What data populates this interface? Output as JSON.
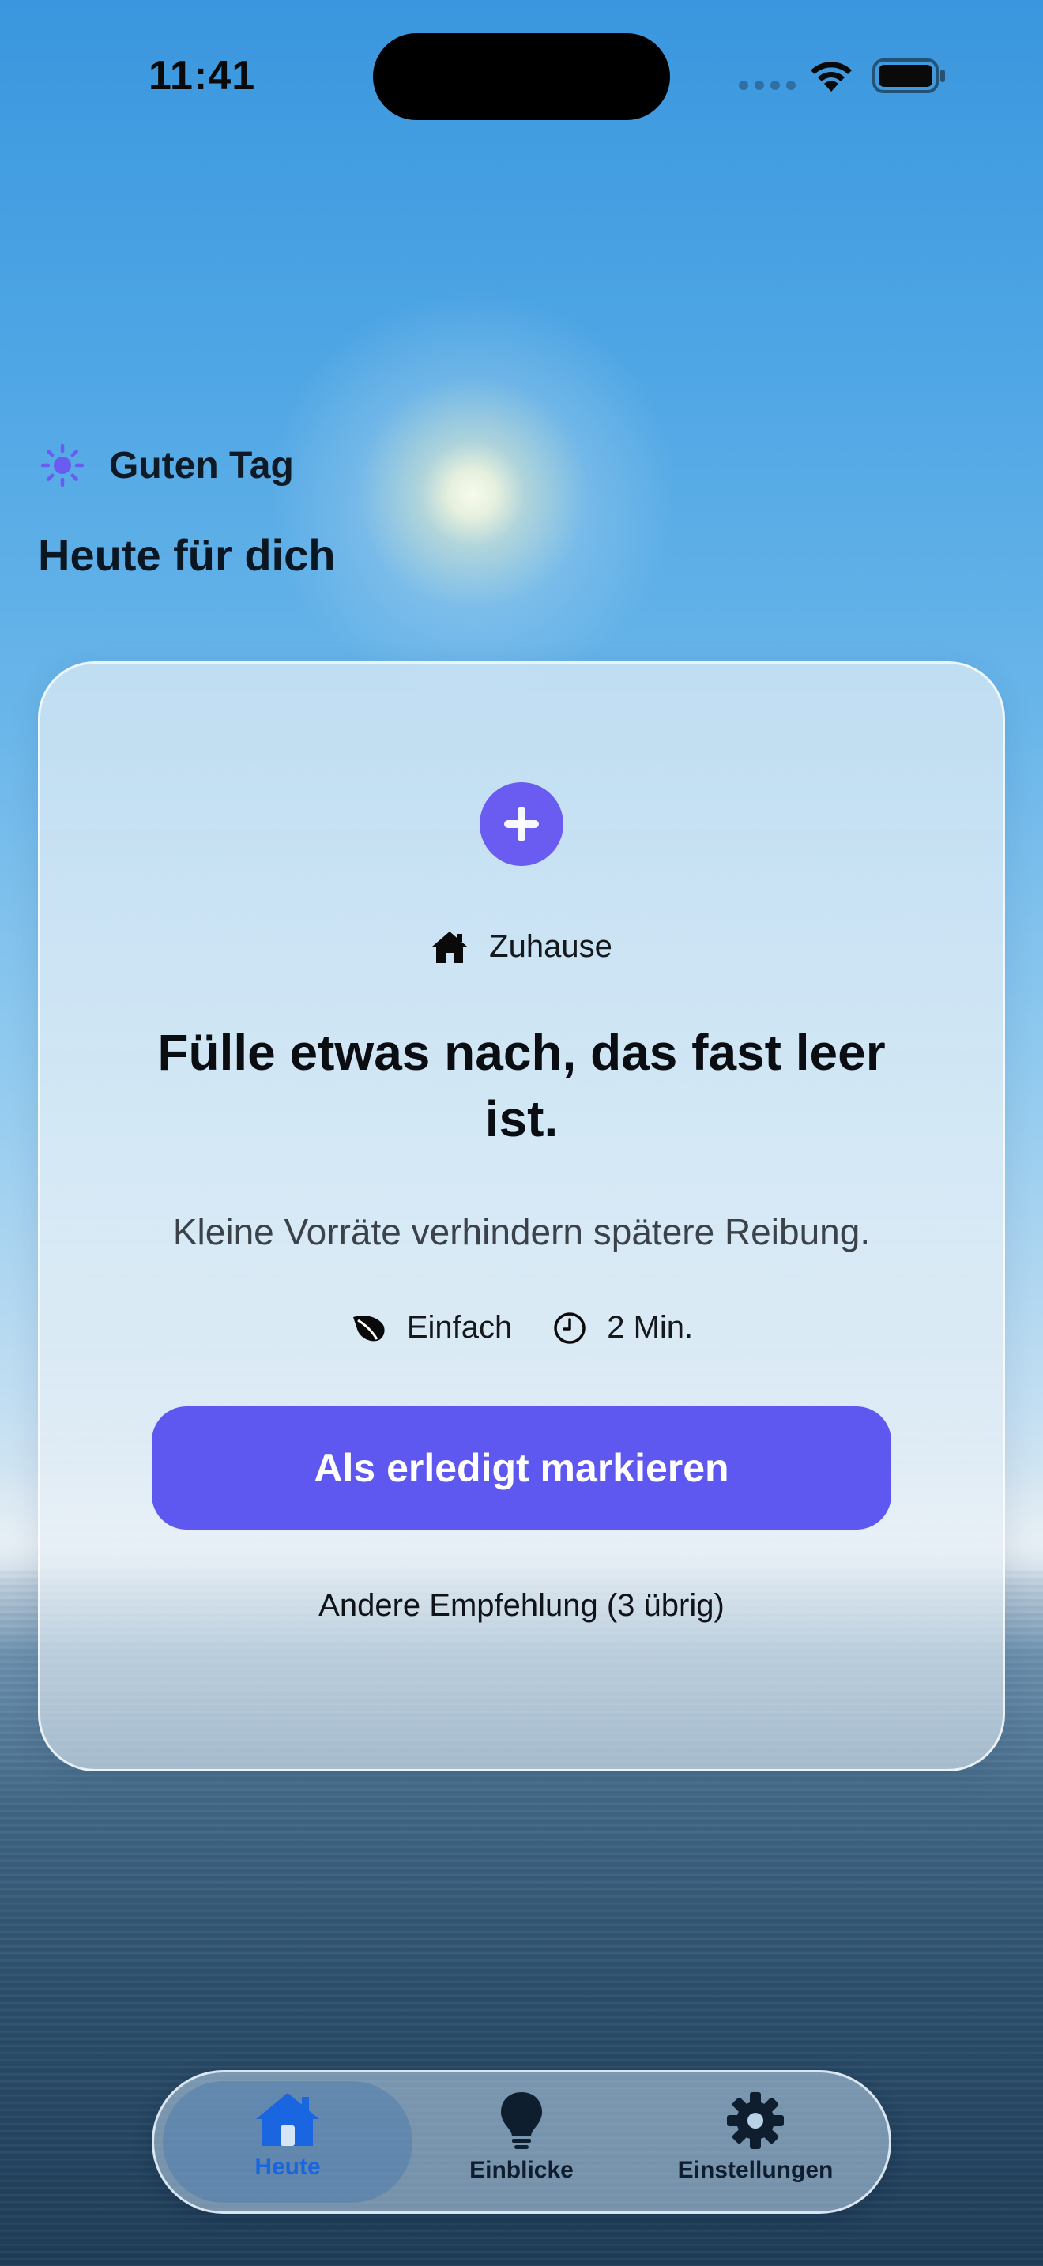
{
  "status_bar": {
    "time": "11:41"
  },
  "greeting": {
    "text": "Guten Tag",
    "icon": "sun-icon"
  },
  "headline": "Heute für dich",
  "card": {
    "badge_icon": "plus-icon",
    "category": {
      "label": "Zuhause",
      "icon": "house-icon"
    },
    "title": "Fülle etwas nach, das fast leer ist.",
    "subtitle": "Kleine Vorräte verhindern spätere Reibung.",
    "difficulty": {
      "label": "Einfach",
      "icon": "leaf-icon"
    },
    "duration": {
      "label": "2 Min.",
      "icon": "clock-icon"
    },
    "primary_action": "Als erledigt markieren",
    "secondary_action": "Andere Empfehlung (3 übrig)"
  },
  "tabbar": {
    "tabs": [
      {
        "label": "Heute",
        "icon": "house-icon",
        "active": true
      },
      {
        "label": "Einblicke",
        "icon": "lightbulb-icon",
        "active": false
      },
      {
        "label": "Einstellungen",
        "icon": "gear-icon",
        "active": false
      }
    ]
  },
  "colors": {
    "accent": "#5f58f0",
    "active_tab": "#1a66e0",
    "sky": "#3a96de"
  }
}
